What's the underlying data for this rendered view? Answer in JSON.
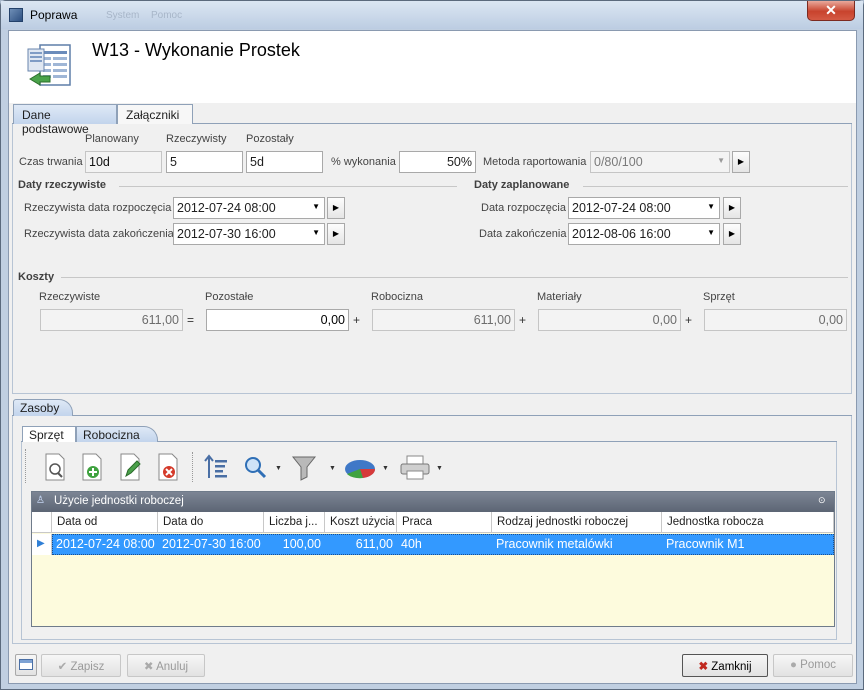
{
  "window": {
    "title": "Poprawa",
    "bg_menu": [
      "System",
      "Pomoc"
    ],
    "close_glyph": "✕",
    "page_title": "W13 - Wykonanie Prostek"
  },
  "top_tabs": [
    {
      "label": "Dane podstawowe",
      "active": true
    },
    {
      "label": "Załączniki",
      "active": false
    }
  ],
  "duration": {
    "col_labels": [
      "Planowany",
      "Rzeczywisty",
      "Pozostały"
    ],
    "row_label": "Czas trwania",
    "planned": "10d",
    "actual": "5",
    "remaining": "5d",
    "percent_label": "% wykonania",
    "percent_value": "50%",
    "method_label": "Metoda raportowania",
    "method_value": "0/80/100"
  },
  "actual_dates": {
    "heading": "Daty rzeczywiste",
    "start_label": "Rzeczywista data rozpoczęcia",
    "start_value": "2012-07-24 08:00",
    "end_label": "Rzeczywista data zakończenia",
    "end_value": "2012-07-30 16:00"
  },
  "planned_dates": {
    "heading": "Daty zaplanowane",
    "start_label": "Data rozpoczęcia",
    "start_value": "2012-07-24 08:00",
    "end_label": "Data zakończenia",
    "end_value": "2012-08-06 16:00"
  },
  "costs": {
    "heading": "Koszty",
    "labels": [
      "Rzeczywiste",
      "Pozostałe",
      "Robocizna",
      "Materiały",
      "Sprzęt"
    ],
    "values": [
      "611,00",
      "0,00",
      "611,00",
      "0,00",
      "0,00"
    ],
    "operators": [
      "=",
      "+",
      "+",
      "+"
    ]
  },
  "resources": {
    "tab_label": "Zasoby",
    "sub_tabs": [
      {
        "label": "Sprzęt",
        "active": true
      },
      {
        "label": "Robocizna",
        "active": false
      }
    ],
    "toolbar_icons": [
      "preview-icon",
      "add-icon",
      "edit-icon",
      "delete-icon",
      "sort-icon",
      "search-icon",
      "filter-icon",
      "chart-icon",
      "print-icon"
    ],
    "grid": {
      "panel_title": "Użycie jednostki roboczej",
      "columns": [
        "Data od",
        "Data do",
        "Liczba j...",
        "Koszt użycia",
        "Praca",
        "Rodzaj jednostki roboczej",
        "Jednostka robocza"
      ],
      "rows": [
        [
          "2012-07-24 08:00",
          "2012-07-30 16:00",
          "100,00",
          "611,00",
          "40h",
          "Pracownik metalówki",
          "Pracownik M1"
        ]
      ],
      "selection_color": "#3399ff",
      "empty_area_color": "#fdfbdd"
    }
  },
  "footer": {
    "save": "Zapisz",
    "cancel": "Anuluj",
    "close": "Zamknij",
    "help": "Pomoc"
  }
}
